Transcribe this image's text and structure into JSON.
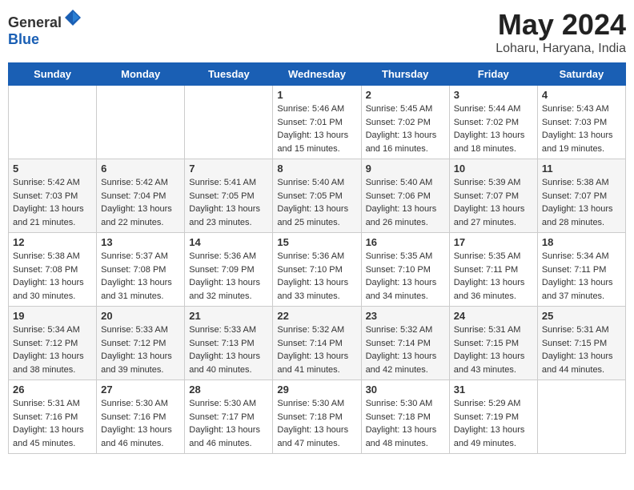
{
  "header": {
    "logo_general": "General",
    "logo_blue": "Blue",
    "month_year": "May 2024",
    "location": "Loharu, Haryana, India"
  },
  "days_of_week": [
    "Sunday",
    "Monday",
    "Tuesday",
    "Wednesday",
    "Thursday",
    "Friday",
    "Saturday"
  ],
  "weeks": [
    [
      {
        "day": "",
        "sunrise": "",
        "sunset": "",
        "daylight": ""
      },
      {
        "day": "",
        "sunrise": "",
        "sunset": "",
        "daylight": ""
      },
      {
        "day": "",
        "sunrise": "",
        "sunset": "",
        "daylight": ""
      },
      {
        "day": "1",
        "sunrise": "Sunrise: 5:46 AM",
        "sunset": "Sunset: 7:01 PM",
        "daylight": "Daylight: 13 hours and 15 minutes."
      },
      {
        "day": "2",
        "sunrise": "Sunrise: 5:45 AM",
        "sunset": "Sunset: 7:02 PM",
        "daylight": "Daylight: 13 hours and 16 minutes."
      },
      {
        "day": "3",
        "sunrise": "Sunrise: 5:44 AM",
        "sunset": "Sunset: 7:02 PM",
        "daylight": "Daylight: 13 hours and 18 minutes."
      },
      {
        "day": "4",
        "sunrise": "Sunrise: 5:43 AM",
        "sunset": "Sunset: 7:03 PM",
        "daylight": "Daylight: 13 hours and 19 minutes."
      }
    ],
    [
      {
        "day": "5",
        "sunrise": "Sunrise: 5:42 AM",
        "sunset": "Sunset: 7:03 PM",
        "daylight": "Daylight: 13 hours and 21 minutes."
      },
      {
        "day": "6",
        "sunrise": "Sunrise: 5:42 AM",
        "sunset": "Sunset: 7:04 PM",
        "daylight": "Daylight: 13 hours and 22 minutes."
      },
      {
        "day": "7",
        "sunrise": "Sunrise: 5:41 AM",
        "sunset": "Sunset: 7:05 PM",
        "daylight": "Daylight: 13 hours and 23 minutes."
      },
      {
        "day": "8",
        "sunrise": "Sunrise: 5:40 AM",
        "sunset": "Sunset: 7:05 PM",
        "daylight": "Daylight: 13 hours and 25 minutes."
      },
      {
        "day": "9",
        "sunrise": "Sunrise: 5:40 AM",
        "sunset": "Sunset: 7:06 PM",
        "daylight": "Daylight: 13 hours and 26 minutes."
      },
      {
        "day": "10",
        "sunrise": "Sunrise: 5:39 AM",
        "sunset": "Sunset: 7:07 PM",
        "daylight": "Daylight: 13 hours and 27 minutes."
      },
      {
        "day": "11",
        "sunrise": "Sunrise: 5:38 AM",
        "sunset": "Sunset: 7:07 PM",
        "daylight": "Daylight: 13 hours and 28 minutes."
      }
    ],
    [
      {
        "day": "12",
        "sunrise": "Sunrise: 5:38 AM",
        "sunset": "Sunset: 7:08 PM",
        "daylight": "Daylight: 13 hours and 30 minutes."
      },
      {
        "day": "13",
        "sunrise": "Sunrise: 5:37 AM",
        "sunset": "Sunset: 7:08 PM",
        "daylight": "Daylight: 13 hours and 31 minutes."
      },
      {
        "day": "14",
        "sunrise": "Sunrise: 5:36 AM",
        "sunset": "Sunset: 7:09 PM",
        "daylight": "Daylight: 13 hours and 32 minutes."
      },
      {
        "day": "15",
        "sunrise": "Sunrise: 5:36 AM",
        "sunset": "Sunset: 7:10 PM",
        "daylight": "Daylight: 13 hours and 33 minutes."
      },
      {
        "day": "16",
        "sunrise": "Sunrise: 5:35 AM",
        "sunset": "Sunset: 7:10 PM",
        "daylight": "Daylight: 13 hours and 34 minutes."
      },
      {
        "day": "17",
        "sunrise": "Sunrise: 5:35 AM",
        "sunset": "Sunset: 7:11 PM",
        "daylight": "Daylight: 13 hours and 36 minutes."
      },
      {
        "day": "18",
        "sunrise": "Sunrise: 5:34 AM",
        "sunset": "Sunset: 7:11 PM",
        "daylight": "Daylight: 13 hours and 37 minutes."
      }
    ],
    [
      {
        "day": "19",
        "sunrise": "Sunrise: 5:34 AM",
        "sunset": "Sunset: 7:12 PM",
        "daylight": "Daylight: 13 hours and 38 minutes."
      },
      {
        "day": "20",
        "sunrise": "Sunrise: 5:33 AM",
        "sunset": "Sunset: 7:12 PM",
        "daylight": "Daylight: 13 hours and 39 minutes."
      },
      {
        "day": "21",
        "sunrise": "Sunrise: 5:33 AM",
        "sunset": "Sunset: 7:13 PM",
        "daylight": "Daylight: 13 hours and 40 minutes."
      },
      {
        "day": "22",
        "sunrise": "Sunrise: 5:32 AM",
        "sunset": "Sunset: 7:14 PM",
        "daylight": "Daylight: 13 hours and 41 minutes."
      },
      {
        "day": "23",
        "sunrise": "Sunrise: 5:32 AM",
        "sunset": "Sunset: 7:14 PM",
        "daylight": "Daylight: 13 hours and 42 minutes."
      },
      {
        "day": "24",
        "sunrise": "Sunrise: 5:31 AM",
        "sunset": "Sunset: 7:15 PM",
        "daylight": "Daylight: 13 hours and 43 minutes."
      },
      {
        "day": "25",
        "sunrise": "Sunrise: 5:31 AM",
        "sunset": "Sunset: 7:15 PM",
        "daylight": "Daylight: 13 hours and 44 minutes."
      }
    ],
    [
      {
        "day": "26",
        "sunrise": "Sunrise: 5:31 AM",
        "sunset": "Sunset: 7:16 PM",
        "daylight": "Daylight: 13 hours and 45 minutes."
      },
      {
        "day": "27",
        "sunrise": "Sunrise: 5:30 AM",
        "sunset": "Sunset: 7:16 PM",
        "daylight": "Daylight: 13 hours and 46 minutes."
      },
      {
        "day": "28",
        "sunrise": "Sunrise: 5:30 AM",
        "sunset": "Sunset: 7:17 PM",
        "daylight": "Daylight: 13 hours and 46 minutes."
      },
      {
        "day": "29",
        "sunrise": "Sunrise: 5:30 AM",
        "sunset": "Sunset: 7:18 PM",
        "daylight": "Daylight: 13 hours and 47 minutes."
      },
      {
        "day": "30",
        "sunrise": "Sunrise: 5:30 AM",
        "sunset": "Sunset: 7:18 PM",
        "daylight": "Daylight: 13 hours and 48 minutes."
      },
      {
        "day": "31",
        "sunrise": "Sunrise: 5:29 AM",
        "sunset": "Sunset: 7:19 PM",
        "daylight": "Daylight: 13 hours and 49 minutes."
      },
      {
        "day": "",
        "sunrise": "",
        "sunset": "",
        "daylight": ""
      }
    ]
  ]
}
